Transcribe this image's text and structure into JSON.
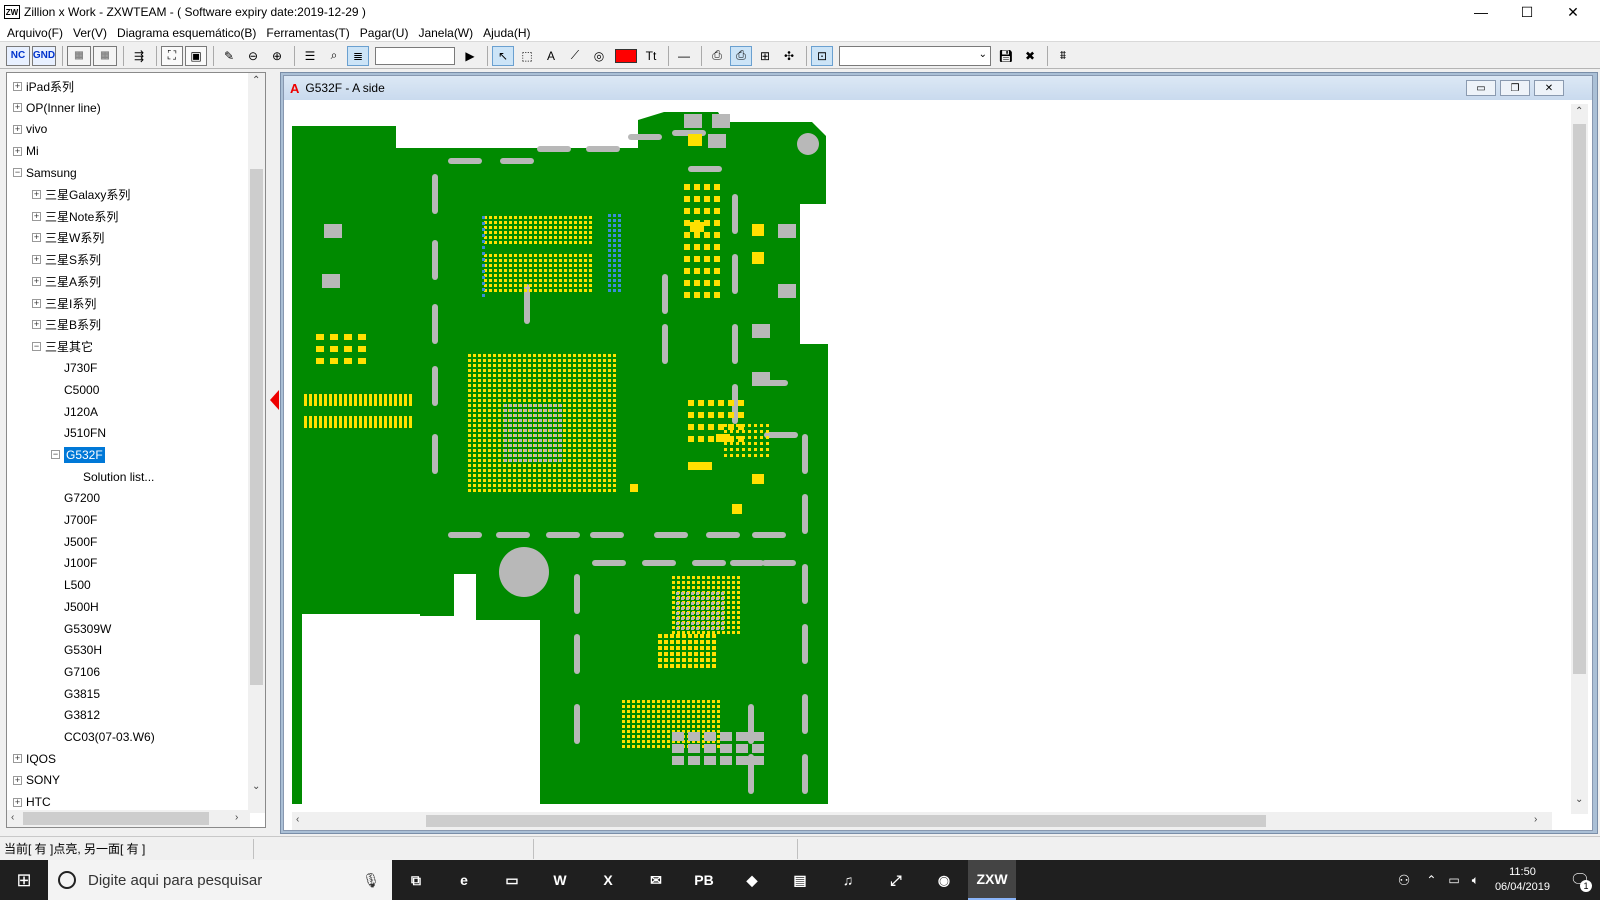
{
  "window": {
    "icon_text": "ZW",
    "title": "Zillion x Work - ZXWTEAM - ( Software expiry date:2019-12-29 )",
    "controls": {
      "minimize": "—",
      "maximize": "☐",
      "close": "✕"
    }
  },
  "menu": [
    "Arquivo(F)",
    "Ver(V)",
    "Diagrama esquemático(B)",
    "Ferramentas(T)",
    "Pagar(U)",
    "Janela(W)",
    "Ajuda(H)"
  ],
  "toolbar": {
    "nc_label": "NC",
    "gnd_label": "GND",
    "color_accent": "#ff0000",
    "tt_label": "Tt",
    "search_value": "",
    "combo_value": ""
  },
  "tree": {
    "items": [
      {
        "label": "iPad系列",
        "level": 0,
        "expander": "+"
      },
      {
        "label": "OP(Inner line)",
        "level": 0,
        "expander": "+"
      },
      {
        "label": "vivo",
        "level": 0,
        "expander": "+"
      },
      {
        "label": "Mi",
        "level": 0,
        "expander": "+"
      },
      {
        "label": "Samsung",
        "level": 0,
        "expander": "−"
      },
      {
        "label": "三星Galaxy系列",
        "level": 1,
        "expander": "+"
      },
      {
        "label": "三星Note系列",
        "level": 1,
        "expander": "+"
      },
      {
        "label": "三星W系列",
        "level": 1,
        "expander": "+"
      },
      {
        "label": "三星S系列",
        "level": 1,
        "expander": "+"
      },
      {
        "label": "三星A系列",
        "level": 1,
        "expander": "+"
      },
      {
        "label": "三星I系列",
        "level": 1,
        "expander": "+"
      },
      {
        "label": "三星B系列",
        "level": 1,
        "expander": "+"
      },
      {
        "label": "三星其它",
        "level": 1,
        "expander": "−"
      },
      {
        "label": "J730F",
        "level": 2,
        "expander": ""
      },
      {
        "label": "C5000",
        "level": 2,
        "expander": ""
      },
      {
        "label": "J120A",
        "level": 2,
        "expander": ""
      },
      {
        "label": "J510FN",
        "level": 2,
        "expander": ""
      },
      {
        "label": "G532F",
        "level": 2,
        "expander": "−",
        "selected": true
      },
      {
        "label": "Solution list...",
        "level": 3,
        "expander": ""
      },
      {
        "label": "G7200",
        "level": 2,
        "expander": ""
      },
      {
        "label": "J700F",
        "level": 2,
        "expander": ""
      },
      {
        "label": "J500F",
        "level": 2,
        "expander": ""
      },
      {
        "label": "J100F",
        "level": 2,
        "expander": ""
      },
      {
        "label": "L500",
        "level": 2,
        "expander": ""
      },
      {
        "label": "J500H",
        "level": 2,
        "expander": ""
      },
      {
        "label": "G5309W",
        "level": 2,
        "expander": ""
      },
      {
        "label": "G530H",
        "level": 2,
        "expander": ""
      },
      {
        "label": "G7106",
        "level": 2,
        "expander": ""
      },
      {
        "label": "G3815",
        "level": 2,
        "expander": ""
      },
      {
        "label": "G3812",
        "level": 2,
        "expander": ""
      },
      {
        "label": "CC03(07-03.W6)",
        "level": 2,
        "expander": ""
      },
      {
        "label": "IQOS",
        "level": 0,
        "expander": "+"
      },
      {
        "label": "SONY",
        "level": 0,
        "expander": "+"
      },
      {
        "label": "HTC",
        "level": 0,
        "expander": "+"
      }
    ]
  },
  "child_window": {
    "icon": "A",
    "title": "G532F - A side",
    "board_color": "#008a00",
    "pad_color": "#ffe000",
    "via_color": "#3a8fd8",
    "slot_color": "#b8b8b8"
  },
  "status": {
    "text": "当前[ 有 ]点亮, 另一面[ 有 ]"
  },
  "taskbar": {
    "search_placeholder": "Digite aqui para pesquisar",
    "apps": [
      {
        "name": "task-view",
        "glyph": "⧉"
      },
      {
        "name": "edge",
        "glyph": "e"
      },
      {
        "name": "file-explorer",
        "glyph": "▭"
      },
      {
        "name": "word",
        "glyph": "W"
      },
      {
        "name": "excel",
        "glyph": "X"
      },
      {
        "name": "mail",
        "glyph": "✉"
      },
      {
        "name": "pb",
        "glyph": "PB"
      },
      {
        "name": "app-blue",
        "glyph": "◆"
      },
      {
        "name": "app-printer",
        "glyph": "▤"
      },
      {
        "name": "itunes",
        "glyph": "♫"
      },
      {
        "name": "app-chart",
        "glyph": "⤢"
      },
      {
        "name": "chrome",
        "glyph": "◉"
      },
      {
        "name": "zxw",
        "glyph": "ZXW"
      }
    ],
    "time": "11:50",
    "date": "06/04/2019",
    "notification_count": "1"
  }
}
